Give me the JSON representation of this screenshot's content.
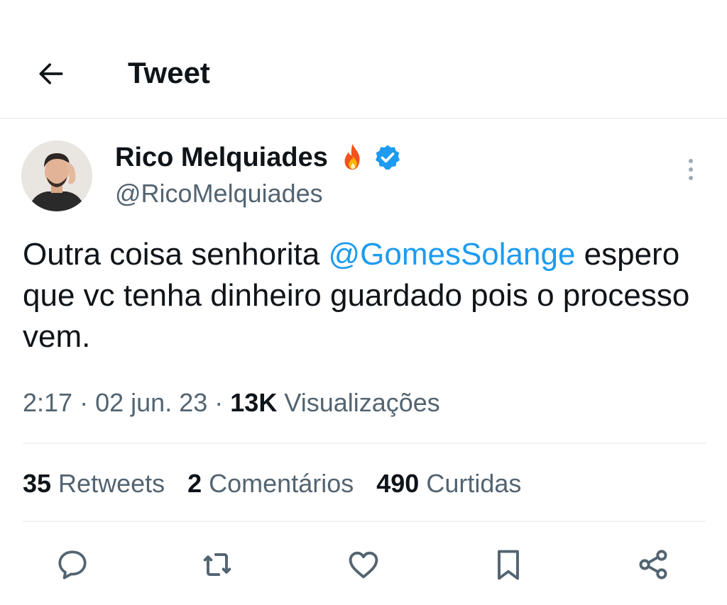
{
  "header": {
    "title": "Tweet"
  },
  "tweet": {
    "author_name": "Rico Melquiades",
    "author_handle": "@RicoMelquiades",
    "text_before": "Outra coisa senhorita ",
    "mention": "@GomesSolange",
    "text_after": " espero que vc tenha dinheiro guardado pois o processo vem.",
    "time": "2:17",
    "separator": "·",
    "date": "02 jun. 23",
    "views_count": "13K",
    "views_label": "Visualizações"
  },
  "stats": {
    "retweets_count": "35",
    "retweets_label": "Retweets",
    "comments_count": "2",
    "comments_label": "Comentários",
    "likes_count": "490",
    "likes_label": "Curtidas"
  },
  "icons": {
    "back": "arrow-left-icon",
    "emoji": "fire-emoji-icon",
    "verified": "verified-badge-icon",
    "more": "more-vertical-icon",
    "reply": "comment-icon",
    "retweet": "retweet-icon",
    "like": "heart-icon",
    "bookmark": "bookmark-icon",
    "share": "share-icon"
  },
  "colors": {
    "accent": "#1d9bf0",
    "text_primary": "#0f1419",
    "text_secondary": "#536471",
    "divider": "#eff3f4"
  }
}
